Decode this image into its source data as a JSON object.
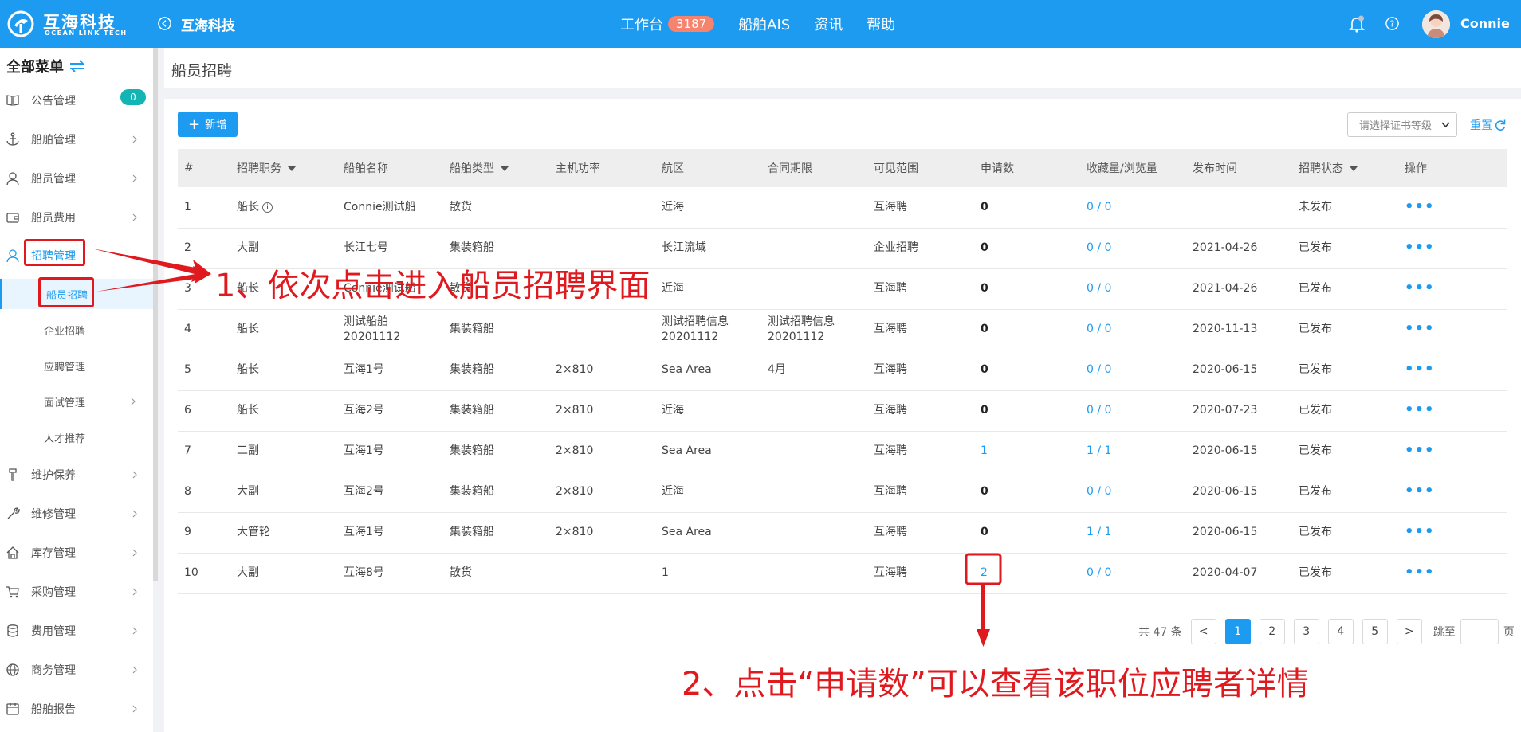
{
  "header": {
    "brand_cn": "互海科技",
    "brand_en": "OCEAN LINK TECH",
    "crumb_title": "互海科技",
    "nav": [
      {
        "label": "工作台",
        "badge": "3187"
      },
      {
        "label": "船舶AIS"
      },
      {
        "label": "资讯"
      },
      {
        "label": "帮助"
      }
    ],
    "username": "Connie"
  },
  "sidebar": {
    "title": "全部菜单",
    "zero_badge": "0",
    "items": [
      {
        "label": "公告管理",
        "icon": "book-icon"
      },
      {
        "label": "船舶管理",
        "icon": "anchor-icon"
      },
      {
        "label": "船员管理",
        "icon": "user-icon"
      },
      {
        "label": "船员费用",
        "icon": "wallet-icon"
      },
      {
        "label": "招聘管理",
        "icon": "recruit-icon"
      },
      {
        "label": "维护保养",
        "icon": "wrench-icon"
      },
      {
        "label": "维修管理",
        "icon": "tools-icon"
      },
      {
        "label": "库存管理",
        "icon": "home-icon"
      },
      {
        "label": "采购管理",
        "icon": "cart-icon"
      },
      {
        "label": "费用管理",
        "icon": "coins-icon"
      },
      {
        "label": "商务管理",
        "icon": "globe-icon"
      },
      {
        "label": "船舶报告",
        "icon": "calendar-icon"
      }
    ],
    "sub_items": [
      {
        "label": "船员招聘"
      },
      {
        "label": "企业招聘"
      },
      {
        "label": "应聘管理"
      },
      {
        "label": "面试管理"
      },
      {
        "label": "人才推荐"
      }
    ]
  },
  "page": {
    "title": "船员招聘",
    "add_label": "新增",
    "cert_placeholder": "请选择证书等级",
    "reset_label": "重置"
  },
  "table": {
    "columns": [
      "#",
      "招聘职务",
      "船舶名称",
      "船舶类型",
      "主机功率",
      "航区",
      "合同期限",
      "可见范围",
      "申请数",
      "收藏量/浏览量",
      "发布时间",
      "招聘状态",
      "操作"
    ],
    "rows": [
      {
        "no": "1",
        "position": "船长",
        "ship": "Connie测试船",
        "type": "散货",
        "power": "",
        "area": "近海",
        "term": "",
        "scope": "互海聘",
        "apply": "0",
        "fav": "0 / 0",
        "date": "",
        "status": "未发布",
        "op": "•••"
      },
      {
        "no": "2",
        "position": "大副",
        "ship": "长江七号",
        "type": "集装箱船",
        "power": "",
        "area": "长江流域",
        "term": "",
        "scope": "企业招聘",
        "apply": "0",
        "fav": "0 / 0",
        "date": "2021-04-26",
        "status": "已发布",
        "op": "•••"
      },
      {
        "no": "3",
        "position": "船长",
        "ship": "Connie测试船",
        "type": "散货",
        "power": "",
        "area": "近海",
        "term": "",
        "scope": "互海聘",
        "apply": "0",
        "fav": "0 / 0",
        "date": "2021-04-26",
        "status": "已发布",
        "op": "•••"
      },
      {
        "no": "4",
        "position": "船长",
        "ship": "测试船舶20201112",
        "type": "集装箱船",
        "power": "",
        "area": "测试招聘信息20201112",
        "term": "测试招聘信息20201112",
        "scope": "互海聘",
        "apply": "0",
        "fav": "0 / 0",
        "date": "2020-11-13",
        "status": "已发布",
        "op": "•••"
      },
      {
        "no": "5",
        "position": "船长",
        "ship": "互海1号",
        "type": "集装箱船",
        "power": "2×810",
        "area": "Sea Area",
        "term": "4月",
        "scope": "互海聘",
        "apply": "0",
        "fav": "0 / 0",
        "date": "2020-06-15",
        "status": "已发布",
        "op": "•••"
      },
      {
        "no": "6",
        "position": "船长",
        "ship": "互海2号",
        "type": "集装箱船",
        "power": "2×810",
        "area": "近海",
        "term": "",
        "scope": "互海聘",
        "apply": "0",
        "fav": "0 / 0",
        "date": "2020-07-23",
        "status": "已发布",
        "op": "•••"
      },
      {
        "no": "7",
        "position": "二副",
        "ship": "互海1号",
        "type": "集装箱船",
        "power": "2×810",
        "area": "Sea Area",
        "term": "",
        "scope": "互海聘",
        "apply": "1",
        "fav": "1 / 1",
        "date": "2020-06-15",
        "status": "已发布",
        "op": "•••"
      },
      {
        "no": "8",
        "position": "大副",
        "ship": "互海2号",
        "type": "集装箱船",
        "power": "2×810",
        "area": "近海",
        "term": "",
        "scope": "互海聘",
        "apply": "0",
        "fav": "0 / 0",
        "date": "2020-06-15",
        "status": "已发布",
        "op": "•••"
      },
      {
        "no": "9",
        "position": "大管轮",
        "ship": "互海1号",
        "type": "集装箱船",
        "power": "2×810",
        "area": "Sea Area",
        "term": "",
        "scope": "互海聘",
        "apply": "0",
        "fav": "1 / 1",
        "date": "2020-06-15",
        "status": "已发布",
        "op": "•••"
      },
      {
        "no": "10",
        "position": "大副",
        "ship": "互海8号",
        "type": "散货",
        "power": "",
        "area": "1",
        "term": "",
        "scope": "互海聘",
        "apply": "2",
        "fav": "0 / 0",
        "date": "2020-04-07",
        "status": "已发布",
        "op": "•••"
      }
    ]
  },
  "pagination": {
    "total": "共 47 条",
    "prev": "<",
    "pages": [
      "1",
      "2",
      "3",
      "4",
      "5"
    ],
    "current": "1",
    "next": ">",
    "jump_label": "跳至",
    "page_unit": "页"
  },
  "annotations": {
    "step1": "1、依次点击进入船员招聘界面",
    "step2": "2、点击“申请数”可以查看该职位应聘者详情"
  },
  "colors": {
    "primary": "#1c9bf0",
    "annotation": "#e0191f",
    "badge": "#f5836d",
    "zero_badge": "#12b4b4"
  }
}
